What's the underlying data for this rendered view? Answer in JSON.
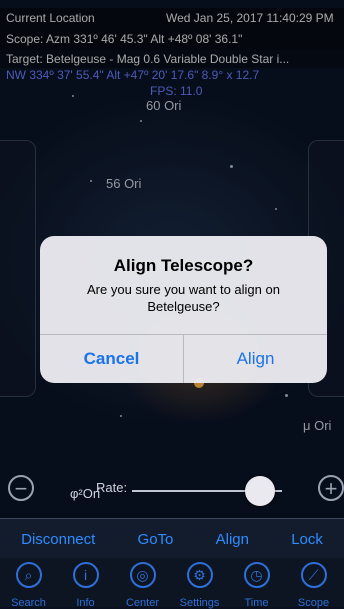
{
  "header": {
    "location": "Current Location",
    "datetime": "Wed Jan 25, 2017 11:40:29 PM",
    "scope": "Scope: Azm 331º 46' 45.3\"  Alt +48º 08' 36.1\"",
    "target": "Target: Betelgeuse - Mag 0.6 Variable Double Star i...",
    "fov": "NW 334º 37' 55.4\" Alt +47º 20' 17.6\"   8.9° x 12.7",
    "fps": "FPS: 11.0"
  },
  "sky_labels": {
    "ori60": "60 Ori",
    "ori56": "56 Ori",
    "mu_ori": "μ Ori",
    "phi2_ori": "φ²Ori"
  },
  "dialog": {
    "title": "Align Telescope?",
    "message": "Are you sure you want to align on Betelgeuse?",
    "cancel": "Cancel",
    "confirm": "Align"
  },
  "rate": {
    "label": "Rate:",
    "value": 0.85
  },
  "actions": [
    "Disconnect",
    "GoTo",
    "Align",
    "Lock"
  ],
  "tabs": [
    {
      "label": "Search",
      "icon": "search-icon"
    },
    {
      "label": "Info",
      "icon": "info-icon"
    },
    {
      "label": "Center",
      "icon": "center-icon"
    },
    {
      "label": "Settings",
      "icon": "gear-icon"
    },
    {
      "label": "Time",
      "icon": "clock-icon"
    },
    {
      "label": "Scope",
      "icon": "telescope-icon"
    }
  ]
}
